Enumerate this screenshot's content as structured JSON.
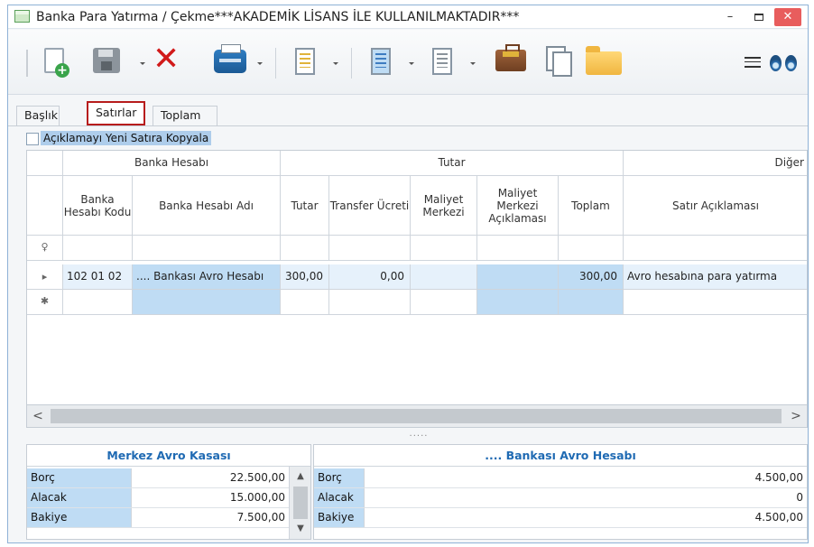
{
  "window": {
    "title": "Banka Para Yatırma / Çekme***AKADEMİK LİSANS İLE KULLANILMAKTADIR***",
    "minimize": "–",
    "close": "✕"
  },
  "toolbar": {
    "icons": [
      "new-document-icon",
      "save-icon",
      "delete-icon",
      "print-icon",
      "report-icon",
      "list-icon",
      "form-icon",
      "briefcase-icon",
      "copy-icon",
      "folder-icon",
      "fit-width-icon",
      "binoculars-icon"
    ]
  },
  "tabs": [
    {
      "label": "Başlık",
      "active": false
    },
    {
      "label": "Satırlar",
      "active": true
    },
    {
      "label": "Toplam",
      "active": false
    }
  ],
  "options": {
    "copy_description_label": "Açıklamayı Yeni Satıra Kopyala",
    "checked": false
  },
  "grid": {
    "groups": [
      "Banka Hesabı",
      "Tutar",
      "Diğer"
    ],
    "columns": [
      "Banka Hesabı Kodu",
      "Banka Hesabı Adı",
      "Tutar",
      "Transfer Ücreti",
      "Maliyet Merkezi",
      "Maliyet Merkezi Açıklaması",
      "Toplam",
      "Satır Açıklaması"
    ],
    "row_markers": {
      "filter": "♀",
      "current": "▸",
      "new": "✱"
    },
    "rows": [
      {
        "code": "102 01 02",
        "name": ".... Bankası Avro Hesabı",
        "amount": "300,00",
        "transfer_fee": "0,00",
        "cost_center": "",
        "cost_center_desc": "",
        "total": "300,00",
        "line_desc": "Avro hesabına para yatırma"
      }
    ],
    "scroll_left": "<",
    "scroll_right": ">",
    "splitter": "....."
  },
  "summary_left": {
    "title": "Merkez Avro Kasası",
    "rows": [
      {
        "label": "Borç",
        "value": "22.500,00"
      },
      {
        "label": "Alacak",
        "value": "15.000,00"
      },
      {
        "label": "Bakiye",
        "value": "7.500,00"
      }
    ],
    "scroll_up": "▲",
    "scroll_down": "▼"
  },
  "summary_right": {
    "title": ".... Bankası Avro Hesabı",
    "rows": [
      {
        "label": "Borç",
        "value": "4.500,00"
      },
      {
        "label": "Alacak",
        "value": "0"
      },
      {
        "label": "Bakiye",
        "value": "4.500,00"
      }
    ]
  },
  "colors": {
    "accent_blue": "#1f6ab3",
    "highlight_blue": "#bfdcf4",
    "active_tab_border": "#b71c1c",
    "close_button": "#e85d5d"
  }
}
